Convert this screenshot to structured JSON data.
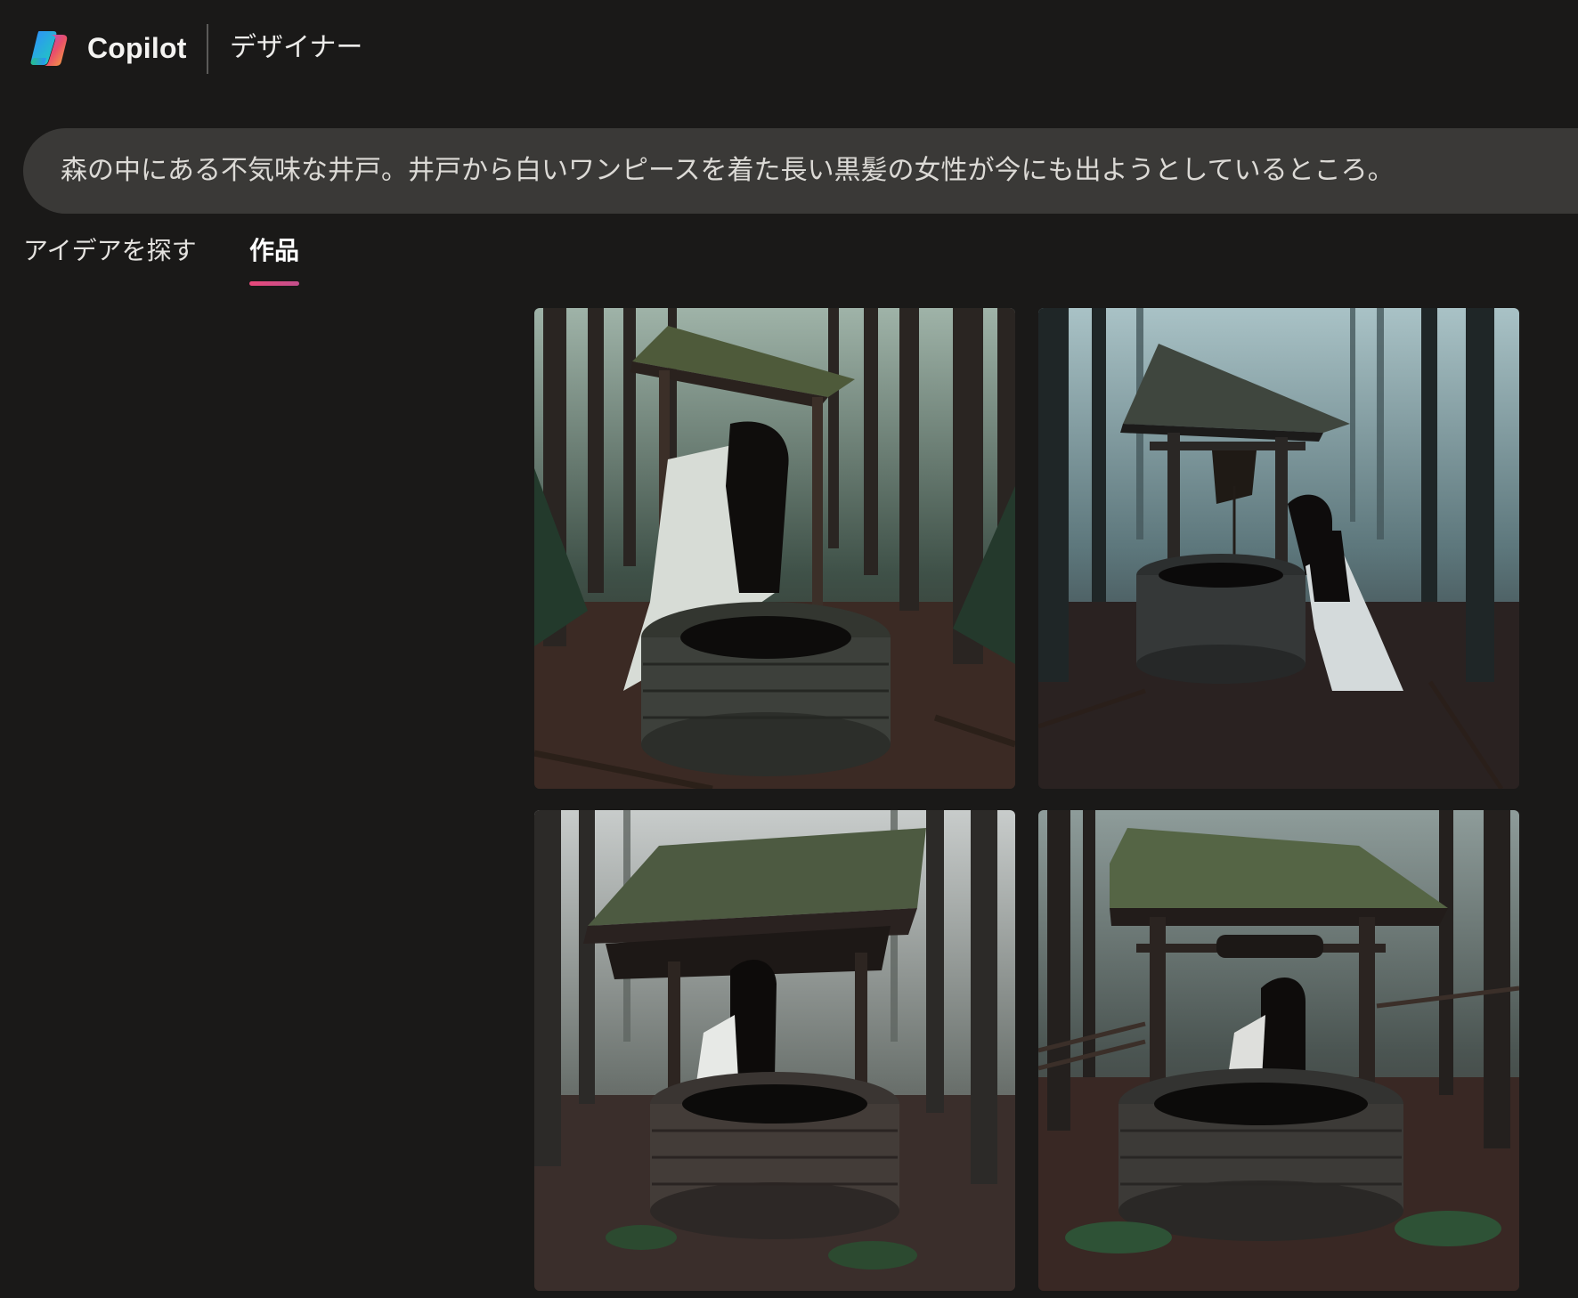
{
  "header": {
    "brand": "Copilot",
    "product": "デザイナー",
    "logo_icon": "copilot-logo-icon"
  },
  "prompt": {
    "text": "森の中にある不気味な井戸。井戸から白いワンピースを着た長い黒髪の女性が今にも出ようとしているところ。"
  },
  "tabs": [
    {
      "label": "アイデアを探す",
      "active": false
    },
    {
      "label": "作品",
      "active": true
    }
  ],
  "colors": {
    "background": "#1a1918",
    "prompt_bar": "#3a3937",
    "tab_underline": "#e8487a"
  },
  "gallery": {
    "images": [
      {
        "name": "generated-image-1"
      },
      {
        "name": "generated-image-2"
      },
      {
        "name": "generated-image-3"
      },
      {
        "name": "generated-image-4"
      }
    ]
  }
}
